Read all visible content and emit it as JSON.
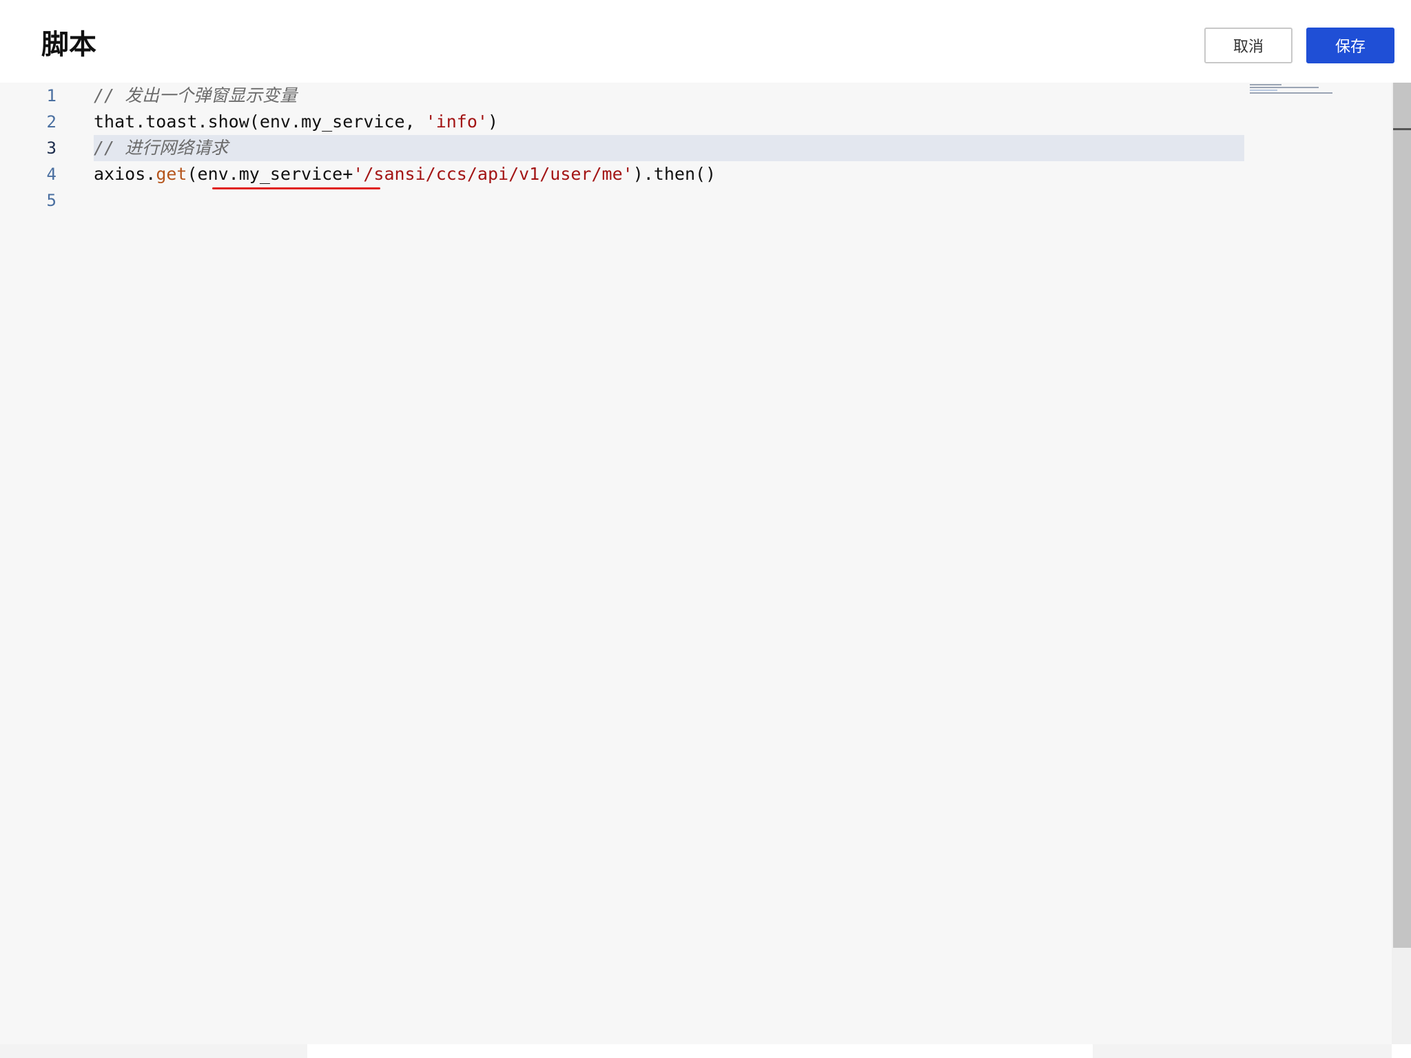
{
  "header": {
    "title": "脚本",
    "cancel_label": "取消",
    "save_label": "保存"
  },
  "editor": {
    "active_line": 3,
    "lines": [
      {
        "number": "1",
        "parts": [
          {
            "type": "comment",
            "text": "// 发出一个弹窗显示变量"
          }
        ]
      },
      {
        "number": "2",
        "parts": [
          {
            "type": "plain",
            "text": "that.toast.show(env.my_service, "
          },
          {
            "type": "string",
            "text": "'info'"
          },
          {
            "type": "plain",
            "text": ")"
          }
        ]
      },
      {
        "number": "3",
        "parts": [
          {
            "type": "comment",
            "text": "// 进行网络请求"
          }
        ]
      },
      {
        "number": "4",
        "parts": [
          {
            "type": "plain",
            "text": "axios."
          },
          {
            "type": "method",
            "text": "get"
          },
          {
            "type": "plain",
            "text": "(env.my_service+"
          },
          {
            "type": "string",
            "text": "'/sansi/ccs/api/v1/user/me'"
          },
          {
            "type": "plain",
            "text": ").then()"
          }
        ]
      },
      {
        "number": "5",
        "parts": []
      }
    ]
  },
  "colors": {
    "save_button": "#1f4fd6",
    "line_number": "#4a6fa0",
    "string": "#a31515",
    "comment": "#6b6b6b",
    "method": "#b5551c",
    "error_underline": "#e0201c",
    "active_line_bg": "#e3e7ef"
  }
}
